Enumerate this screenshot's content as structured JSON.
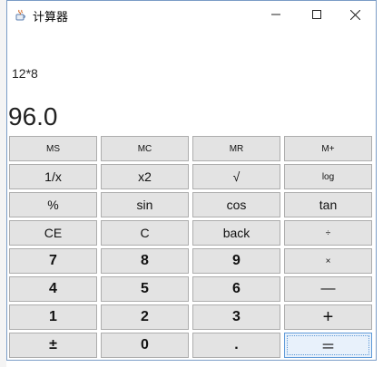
{
  "window": {
    "title": "计算器",
    "app_icon": "java-cup-icon",
    "controls": {
      "minimize": "minimize-icon",
      "maximize": "maximize-icon",
      "close": "close-icon"
    }
  },
  "display": {
    "expression": "12*8",
    "result": "96.0"
  },
  "keys": [
    [
      "MS",
      "MC",
      "MR",
      "M+"
    ],
    [
      "1/x",
      "x2",
      "√",
      "log"
    ],
    [
      "%",
      "sin",
      "cos",
      "tan"
    ],
    [
      "CE",
      "C",
      "back",
      "÷"
    ],
    [
      "7",
      "8",
      "9",
      "×"
    ],
    [
      "4",
      "5",
      "6",
      "—"
    ],
    [
      "1",
      "2",
      "3",
      "+"
    ],
    [
      "±",
      "0",
      ".",
      "＝"
    ]
  ]
}
